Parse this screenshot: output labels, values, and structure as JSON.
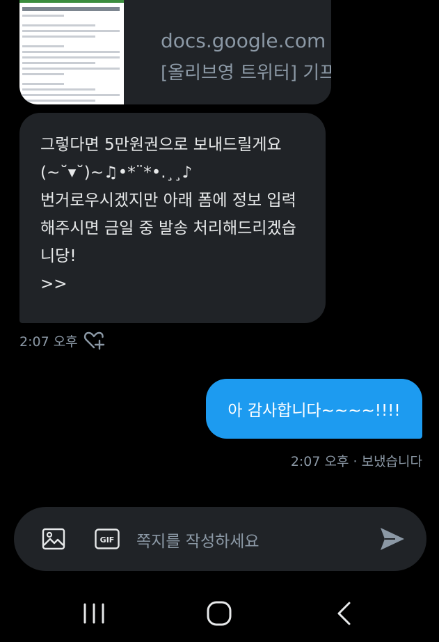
{
  "link_preview": {
    "domain": "docs.google.com",
    "title": "[올리브영 트위터] 기프...",
    "thumbnail_text": "[올리브영 트위터] 기프트카드 발송 정보 입력 폼"
  },
  "incoming_message": {
    "lines": [
      "그렇다면 5만원권으로 보내드릴게요",
      "(~˘▾˘)~♫•*¨*•.¸¸♪",
      "번거로우시겠지만 아래 폼에 정보 입력",
      "해주시면 금일 중 발송 처리해드리겠습",
      "니당!",
      ">>"
    ],
    "timestamp": "2:07 오후"
  },
  "outgoing_message": {
    "text": "아 감사합니다~~~~!!!!",
    "status": "2:07 오후 · 보냈습니다"
  },
  "composer": {
    "placeholder": "쪽지를 작성하세요",
    "image_icon": "image-icon",
    "gif_icon": "gif-icon",
    "gif_label": "GIF",
    "send_icon": "send-icon"
  },
  "navbar": {
    "recents_icon": "recents-icon",
    "home_icon": "home-icon",
    "back_icon": "back-icon"
  },
  "colors": {
    "background": "#000000",
    "incoming_bubble": "#202327",
    "outgoing_bubble": "#1d9bf0",
    "muted_text": "#8b98a5"
  }
}
